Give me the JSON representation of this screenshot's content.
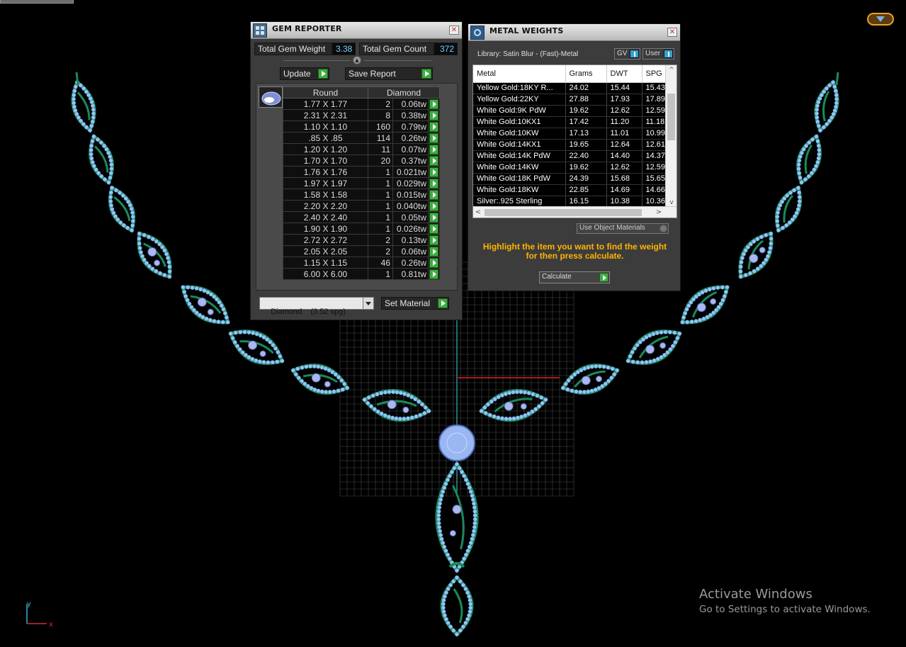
{
  "gem_reporter": {
    "title": "GEM REPORTER",
    "total_gem_weight_label": "Total Gem Weight",
    "total_gem_weight": "3.38",
    "total_gem_count_label": "Total Gem Count",
    "total_gem_count": "372",
    "update_label": "Update",
    "save_report_label": "Save Report",
    "table_headers": [
      "Round",
      "Diamond"
    ],
    "rows": [
      {
        "size": "1.77 X 1.77",
        "count": "2",
        "weight": "0.06tw"
      },
      {
        "size": "2.31 X 2.31",
        "count": "8",
        "weight": "0.38tw"
      },
      {
        "size": "1.10 X 1.10",
        "count": "160",
        "weight": "0.79tw"
      },
      {
        "size": ".85 X .85",
        "count": "114",
        "weight": "0.26tw"
      },
      {
        "size": "1.20 X 1.20",
        "count": "11",
        "weight": "0.07tw"
      },
      {
        "size": "1.70 X 1.70",
        "count": "20",
        "weight": "0.37tw"
      },
      {
        "size": "1.76 X 1.76",
        "count": "1",
        "weight": "0.021tw"
      },
      {
        "size": "1.97 X 1.97",
        "count": "1",
        "weight": "0.029tw"
      },
      {
        "size": "1.58 X 1.58",
        "count": "1",
        "weight": "0.015tw"
      },
      {
        "size": "2.20 X 2.20",
        "count": "1",
        "weight": "0.040tw"
      },
      {
        "size": "2.40 X 2.40",
        "count": "1",
        "weight": "0.05tw"
      },
      {
        "size": "1.90 X 1.90",
        "count": "1",
        "weight": "0.026tw"
      },
      {
        "size": "2.72 X 2.72",
        "count": "2",
        "weight": "0.13tw"
      },
      {
        "size": "2.05 X 2.05",
        "count": "2",
        "weight": "0.06tw"
      },
      {
        "size": "1.15 X 1.15",
        "count": "46",
        "weight": "0.26tw"
      },
      {
        "size": "6.00 X 6.00",
        "count": "1",
        "weight": "0.81tw"
      }
    ],
    "material_select": "Diamond    (3.52 spg)",
    "set_material_label": "Set Material"
  },
  "metal_weights": {
    "title": "METAL WEIGHTS",
    "library_label": "Library: Satin Blur - (Fast)-Metal",
    "gv_label": "GV",
    "user_label": "User",
    "columns": [
      "Metal",
      "Grams",
      "DWT",
      "SPG"
    ],
    "rows": [
      {
        "metal": "Yellow Gold:18KY R...",
        "grams": "24.02",
        "dwt": "15.44",
        "spg": "15.43"
      },
      {
        "metal": "Yellow Gold:22KY",
        "grams": "27.88",
        "dwt": "17.93",
        "spg": "17.89"
      },
      {
        "metal": "White Gold:9K PdW",
        "grams": "19.62",
        "dwt": "12.62",
        "spg": "12.59"
      },
      {
        "metal": "White Gold:10KX1",
        "grams": "17.42",
        "dwt": "11.20",
        "spg": "11.18"
      },
      {
        "metal": "White Gold:10KW",
        "grams": "17.13",
        "dwt": "11.01",
        "spg": "10.99"
      },
      {
        "metal": "White Gold:14KX1",
        "grams": "19.65",
        "dwt": "12.64",
        "spg": "12.61"
      },
      {
        "metal": "White Gold:14K PdW",
        "grams": "22.40",
        "dwt": "14.40",
        "spg": "14.37"
      },
      {
        "metal": "White Gold:14KW",
        "grams": "19.62",
        "dwt": "12.62",
        "spg": "12.59"
      },
      {
        "metal": "White Gold:18K PdW",
        "grams": "24.39",
        "dwt": "15.68",
        "spg": "15.65"
      },
      {
        "metal": "White Gold:18KW",
        "grams": "22.85",
        "dwt": "14.69",
        "spg": "14.66"
      },
      {
        "metal": "Silver:.925 Sterling",
        "grams": "16.15",
        "dwt": "10.38",
        "spg": "10.36"
      }
    ],
    "use_object_materials_label": "Use Object Materials",
    "hint_line1": "Highlight the item you want to find the weight",
    "hint_line2": "for then press calculate.",
    "calculate_label": "Calculate"
  },
  "viewport": {
    "axis_y": "y",
    "axis_x": "x"
  },
  "watermark": {
    "line1": "Activate Windows",
    "line2": "Go to Settings to activate Windows."
  },
  "colors": {
    "metal_green": "#1a8a5a",
    "gem_blue": "#8ec8ef",
    "accent_orange": "#ffb400",
    "go_green": "#3fae3f"
  }
}
